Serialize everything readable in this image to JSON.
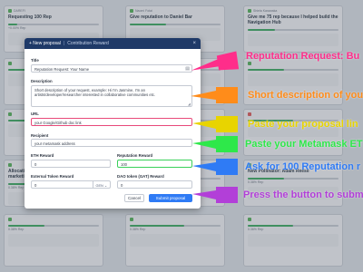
{
  "background": {
    "columns": [
      [
        {
          "meta": "DAREFI",
          "title": "Requesting 100 Rep",
          "stat": "+0.00% Rep",
          "dot": "g",
          "fill": 0.1
        },
        {
          "meta": "",
          "title": "",
          "stat": "",
          "dot": "g",
          "fill": 0.3
        },
        {
          "meta": "",
          "title": "",
          "stat": "",
          "dot": "g",
          "fill": 0.6
        },
        {
          "meta": "",
          "title": "Allocating reputation to Shane - marketing manager @Hyber",
          "stat": "0.38% Rep",
          "dot": "g",
          "fill": 0.5
        },
        {
          "meta": "",
          "title": "",
          "stat": "0.38% Rep",
          "dot": "g",
          "fill": 0.4
        }
      ],
      [
        {
          "meta": "Naomi Fotai",
          "title": "Give reputation to Daniel Bar",
          "stat": "",
          "dot": "g",
          "fill": 0.4
        },
        {
          "meta": "",
          "title": "",
          "stat": "",
          "dot": "r",
          "fill": 0.2
        },
        {
          "meta": "",
          "title": "",
          "stat": "",
          "dot": "y",
          "fill": 0.5
        },
        {
          "meta": "",
          "title": "Requesting 100 REP",
          "stat": "0.38% Rep",
          "dot": "g",
          "fill": 0.3
        },
        {
          "meta": "",
          "title": "",
          "stat": "0.38% Rep",
          "dot": "g",
          "fill": 0.6
        }
      ],
      [
        {
          "meta": "Shiela Karawaka",
          "title": "Give me 75 rep because I helped build the Navigation Hub",
          "stat": "",
          "dot": "g",
          "fill": 0.3
        },
        {
          "meta": "",
          "title": "",
          "stat": "",
          "dot": "g",
          "fill": 0.4
        },
        {
          "meta": "",
          "title": "",
          "stat": "",
          "dot": "r",
          "fill": 0.5
        },
        {
          "meta": "",
          "title": "New Pollinator: Adam Reese",
          "stat": "0.38% Rep",
          "dot": "g",
          "fill": 0.4
        },
        {
          "meta": "",
          "title": "",
          "stat": "0.36% Rep",
          "dot": "g",
          "fill": 0.5
        }
      ]
    ]
  },
  "modal": {
    "title": "+ New proposal",
    "separator": "|",
    "subtitle": "Contribution Reward",
    "close": "×",
    "fields": {
      "title_label": "Title",
      "title_value": "Reputation Request: Your Name",
      "description_label": "Description",
      "description_value": "Short description of your request, example: Hi I'm Jasmine, I'm an artists/developer/researcher interested in collaborative communities etc.",
      "url_label": "URL",
      "url_value": "your Google/Github doc link",
      "recipient_label": "Recipient",
      "recipient_value": "your metamask address",
      "eth_label": "ETH Reward",
      "eth_value": "0",
      "rep_label": "Reputation Reward",
      "rep_value": "100",
      "ext_label": "External Token Reward",
      "ext_value": "0",
      "ext_unit": "GEN ⌄",
      "dao_label": "DAO token (GAT) Reward",
      "dao_value": "0"
    },
    "buttons": {
      "cancel": "Cancel",
      "submit": "Submit proposal"
    }
  },
  "annotations": [
    {
      "text": "Reputation Request: Bu",
      "color": "#ff2d8a"
    },
    {
      "text": "Short description of you",
      "color": "#ff8c1a"
    },
    {
      "text": "Paste your proposal lin",
      "color": "#e8d400"
    },
    {
      "text": "Paste your Metamask ET",
      "color": "#2ee84a"
    },
    {
      "text": "Ask for 100 Reputation r",
      "color": "#2f7bf5"
    },
    {
      "text": "Press the button to subm",
      "color": "#b23fd8"
    }
  ]
}
